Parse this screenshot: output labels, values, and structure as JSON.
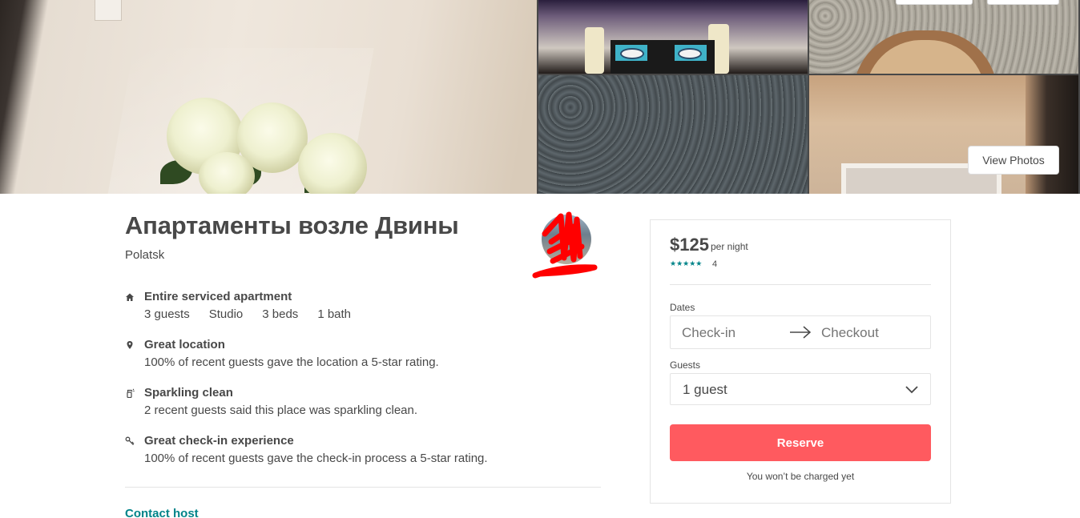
{
  "gallery": {
    "view_photos_label": "View Photos"
  },
  "listing": {
    "title": "Апартаменты возле Двины",
    "city": "Polatsk",
    "features": [
      {
        "icon": "home-icon",
        "title": "Entire serviced apartment",
        "specs": [
          "3 guests",
          "Studio",
          "3 beds",
          "1 bath"
        ]
      },
      {
        "icon": "location-pin-icon",
        "title": "Great location",
        "desc": "100% of recent guests gave the location a 5-star rating."
      },
      {
        "icon": "spray-bottle-icon",
        "title": "Sparkling clean",
        "desc": "2 recent guests said this place was sparkling clean."
      },
      {
        "icon": "key-icon",
        "title": "Great check-in experience",
        "desc": "100% of recent guests gave the check-in process a 5-star rating."
      }
    ],
    "contact_host_label": "Contact host"
  },
  "booking": {
    "price": "$125",
    "per_night": "per night",
    "stars": "★★★★★",
    "rating": 5,
    "review_count": "4",
    "dates_label": "Dates",
    "checkin_placeholder": "Check-in",
    "checkout_placeholder": "Checkout",
    "guests_label": "Guests",
    "guests_value": "1 guest",
    "reserve_label": "Reserve",
    "not_charged": "You won’t be charged yet"
  },
  "colors": {
    "accent": "#ff5a5f",
    "teal": "#008489",
    "text": "#484848",
    "border": "#e4e4e4"
  }
}
